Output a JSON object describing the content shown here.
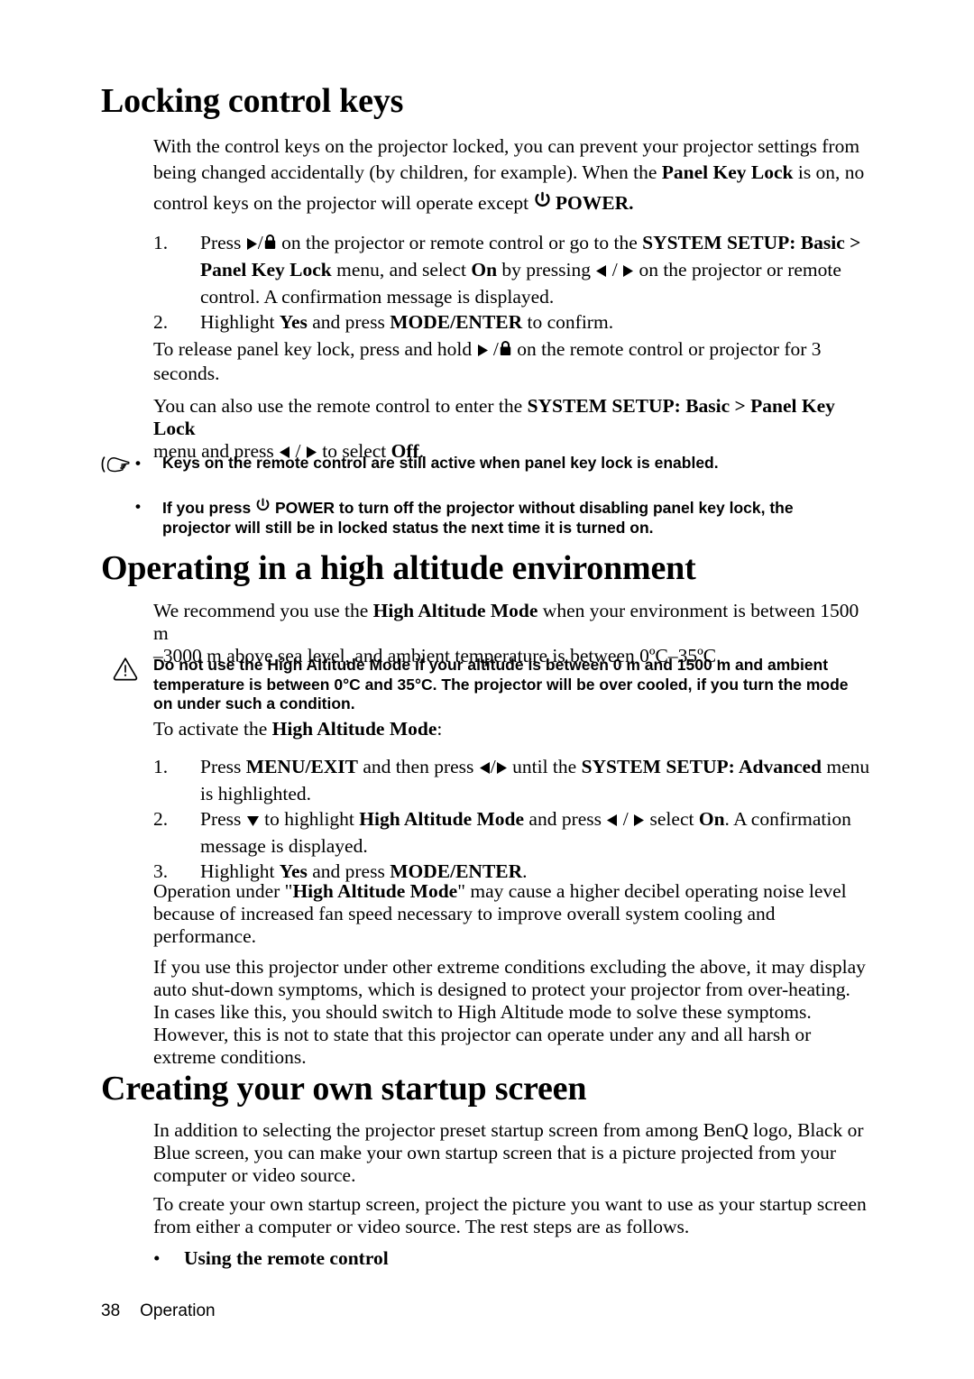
{
  "document": {
    "page_number": "38",
    "footer_section": "Operation"
  },
  "sections": {
    "locking": {
      "title": "Locking control keys",
      "intro_line1": "With the control keys on the projector locked, you can prevent your projector settings from",
      "intro_line2_a": "being changed accidentally (by children, for example). When the ",
      "intro_line2_bold": "Panel Key Lock",
      "intro_line2_b": " is on, no",
      "intro_line3_a": "control keys on the projector will operate except ",
      "intro_line3_b": "POWER.",
      "steps": [
        {
          "marker": "1.",
          "t1": "Press ",
          "t2": " on the projector or remote control or go to the ",
          "b1": "SYSTEM SETUP: Basic >",
          "b2": "Panel Key Lock",
          "t3": " menu, and select ",
          "b3": "On",
          "t4": " by pressing ",
          "t5": " on the projector or remote",
          "t6": "control. A confirmation message is displayed."
        },
        {
          "marker": "2.",
          "t1": "Highlight ",
          "b1": "Yes",
          "t2": " and press ",
          "b2": "MODE/ENTER",
          "t3": " to confirm."
        }
      ],
      "release_a": "To release panel key lock, press and hold ",
      "release_b": " on the remote control or projector for 3",
      "release_c": "seconds.",
      "remote_a": "You can also use the remote control to enter the ",
      "remote_bold": "SYSTEM SETUP: Basic > Panel Key Lock",
      "remote_b": "menu and press ",
      "remote_c": " to select ",
      "remote_off": "Off",
      "remote_d": ".",
      "notes": [
        {
          "bullet": "•",
          "text": "Keys on the remote control are still active when panel key lock is enabled."
        },
        {
          "bullet": "•",
          "text_a": "If you press ",
          "text_b": " POWER to turn off the projector without disabling panel key lock, the",
          "text_c": "projector will still be in locked status the next time it is turned on."
        }
      ]
    },
    "high_altitude": {
      "title": "Operating in a high altitude environment",
      "intro_a": "We recommend you use the ",
      "intro_bold": "High Altitude Mode",
      "intro_b": " when your environment is between 1500 m",
      "intro_c": "–3000 m above sea level, and ambient temperature is between 0ºC–35ºC.",
      "caution_line1": "Do not use the High Altitude Mode if your altitude is between 0 m and 1500 m and ambient",
      "caution_line2": "temperature is between 0°C and 35°C. The projector will be over cooled, if you turn the mode",
      "caution_line3": "on under such a condition.",
      "activate_a": "To activate the ",
      "activate_bold": "High Altitude Mode",
      "activate_b": ":",
      "steps": [
        {
          "marker": "1.",
          "t1": "Press ",
          "b1": "MENU/EXIT",
          "t2": " and then press ",
          "t3": " until the ",
          "b2": "SYSTEM SETUP: Advanced",
          "t4": " menu",
          "t5": "is highlighted."
        },
        {
          "marker": "2.",
          "t1": "Press ",
          "t2": " to highlight ",
          "b1": "High Altitude Mode",
          "t3": " and press ",
          "t4": " select ",
          "b2": "On",
          "t5": ". A confirmation",
          "t6": "message is displayed."
        },
        {
          "marker": "3.",
          "t1": "Highlight ",
          "b1": "Yes",
          "t2": " and press ",
          "b2": "MODE/ENTER",
          "t3": "."
        }
      ],
      "noise_a": "Operation under \"",
      "noise_bold": "High Altitude Mode",
      "noise_b": "\" may cause a higher decibel operating noise level",
      "noise_c": "because of increased fan speed necessary to improve overall system cooling and",
      "noise_d": "performance.",
      "extreme_line1": "If you use this projector under other extreme conditions excluding the above, it may display",
      "extreme_line2": "auto shut-down symptoms, which is designed to protect your projector from over-heating.",
      "extreme_line3": "In cases like this, you should switch to High Altitude mode to solve these symptoms.",
      "extreme_line4": "However, this is not to state that this projector can operate under any and all harsh or",
      "extreme_line5": "extreme conditions."
    },
    "startup": {
      "title": "Creating your own startup screen",
      "p1_line1": "In addition to selecting the projector preset startup screen from among BenQ logo, Black or",
      "p1_line2": "Blue screen, you can make your own startup screen that is a picture projected from your",
      "p1_line3": "computer or video source.",
      "p2_line1": "To create your own startup screen, project the picture you want to use as your startup screen",
      "p2_line2": "from either a computer or video source. The rest steps are as follows.",
      "bullet_dot": "•",
      "bullet_text": "Using the remote control"
    }
  },
  "icons": {
    "power": "power-icon",
    "lock": "lock-icon",
    "hand": "pointing-hand-icon",
    "warning": "warning-triangle-icon",
    "triangle_right": "triangle-right-icon",
    "triangle_left": "triangle-left-icon",
    "triangle_down": "triangle-down-icon"
  }
}
